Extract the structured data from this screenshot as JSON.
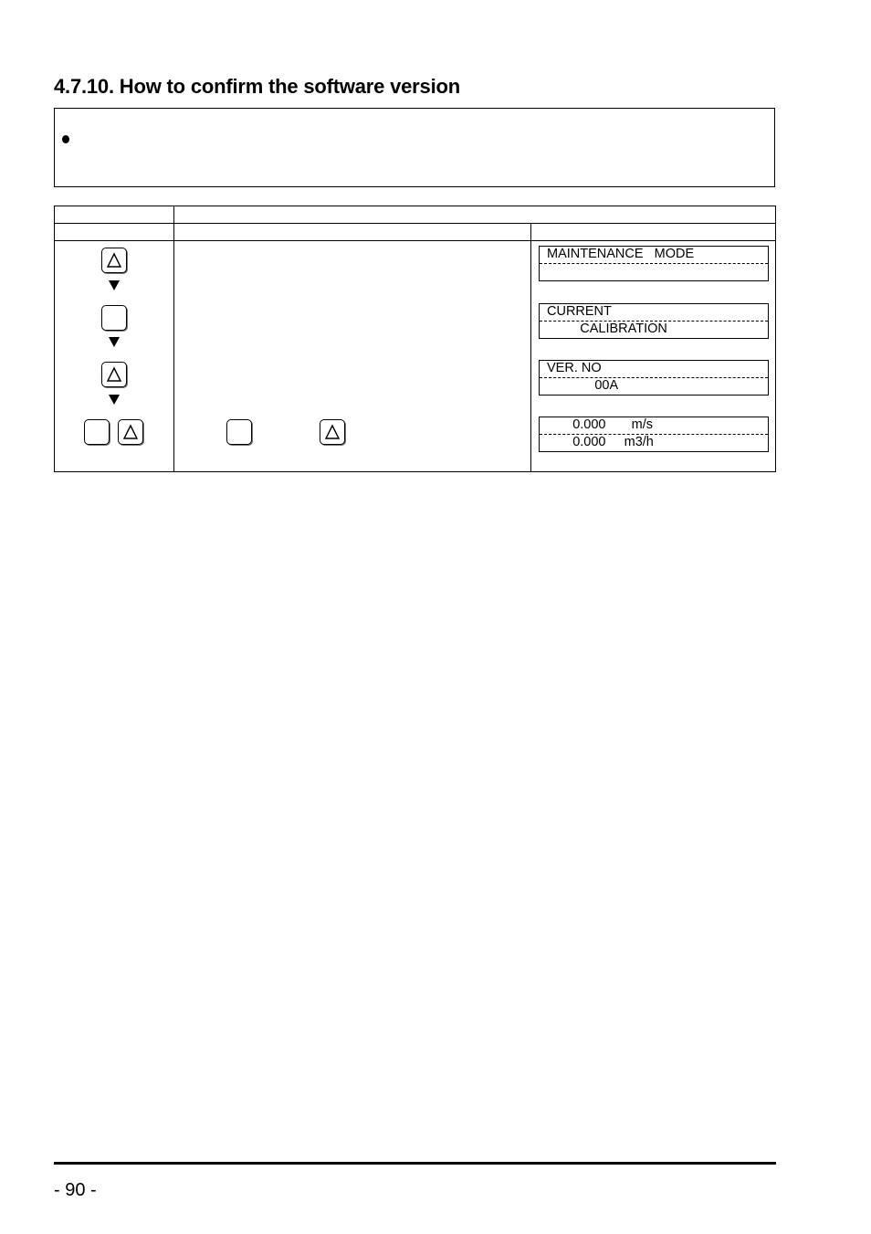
{
  "section": {
    "title": "4.7.10. How to confirm the software version"
  },
  "note_box": {
    "bullet": "•",
    "text": ""
  },
  "procedure_table": {
    "header_row1": [
      "",
      ""
    ],
    "header_row2": [
      "",
      "",
      ""
    ],
    "steps": [
      {
        "keys": [
          "up-key"
        ],
        "description": "",
        "display": {
          "line1": "MAINTENANCE   MODE",
          "line2": ""
        }
      },
      {
        "keys": [
          "ent-key"
        ],
        "description": "",
        "display": {
          "line1": "CURRENT",
          "line2": "         CALIBRATION"
        }
      },
      {
        "keys": [
          "up-key"
        ],
        "description": "",
        "display": {
          "line1": "VER. NO",
          "line2": "             00A"
        }
      },
      {
        "keys": [
          "ent-key",
          "up-key"
        ],
        "description": "",
        "display": {
          "line1": "       0.000       m/s",
          "line2": "       0.000     m3/h"
        }
      }
    ]
  },
  "footer": {
    "page_number": "- 90 -"
  }
}
